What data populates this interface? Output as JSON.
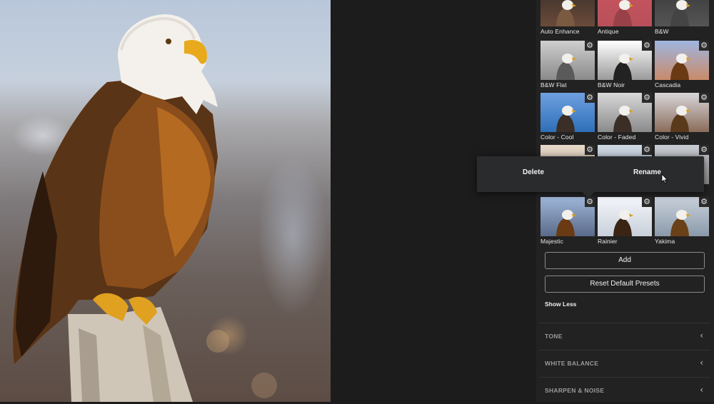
{
  "presets": [
    {
      "label": "Auto Enhance"
    },
    {
      "label": "Antique"
    },
    {
      "label": "B&W"
    },
    {
      "label": "B&W Flat"
    },
    {
      "label": "B&W Noir"
    },
    {
      "label": "Cascadia"
    },
    {
      "label": "Color - Cool"
    },
    {
      "label": "Color - Faded"
    },
    {
      "label": "Color - Vivid"
    },
    {
      "label": ""
    },
    {
      "label": ""
    },
    {
      "label": ""
    },
    {
      "label": "Majestic"
    },
    {
      "label": "Rainier"
    },
    {
      "label": "Yakima"
    }
  ],
  "popup": {
    "delete_label": "Delete",
    "rename_label": "Rename"
  },
  "buttons": {
    "add_label": "Add",
    "reset_label": "Reset Default Presets"
  },
  "show_less_label": "Show Less",
  "sections": [
    {
      "title": "TONE"
    },
    {
      "title": "WHITE BALANCE"
    },
    {
      "title": "SHARPEN & NOISE"
    }
  ],
  "icons": {
    "gear": "gear-icon",
    "chevron": "chevron-left-icon",
    "cursor": "mouse-pointer-icon"
  }
}
